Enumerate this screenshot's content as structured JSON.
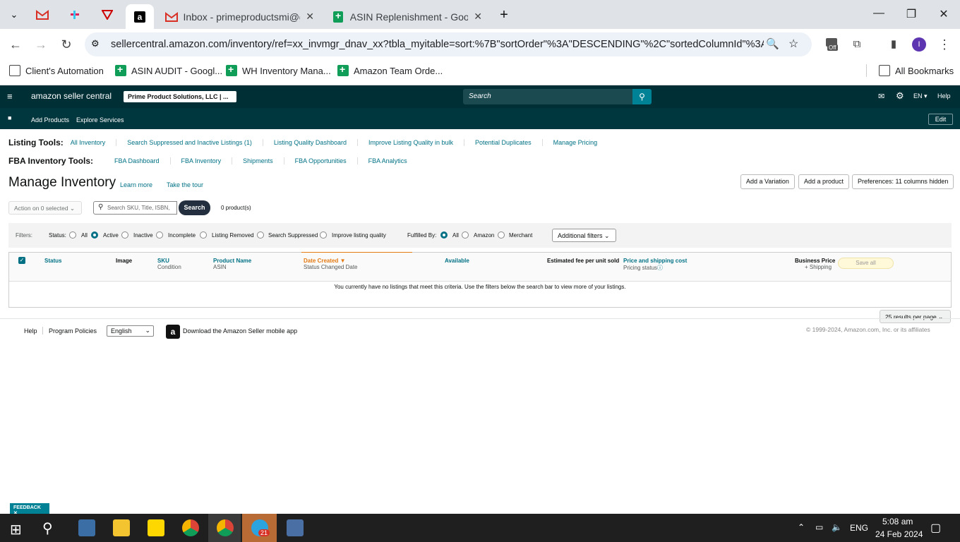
{
  "browser": {
    "tabs": [
      {
        "title": "Inbox - primeproductsmi@gma"
      },
      {
        "title": "ASIN Replenishment - Google S"
      }
    ],
    "url": "sellercentral.amazon.com/inventory/ref=xx_invmgr_dnav_xx?tbla_myitable=sort:%7B\"sortOrder\"%3A\"DESCENDING\"%2C\"sortedColumnId\"%3A\"date...",
    "profile_initial": "I",
    "ext_badge": "Off",
    "bookmarks": [
      "Client's Automation",
      "ASIN AUDIT - Googl...",
      "WH Inventory Mana...",
      "Amazon Team Orde..."
    ],
    "all_bookmarks": "All Bookmarks"
  },
  "seller": {
    "logo": "amazon seller central",
    "store": "Prime Product Solutions, LLC | ...",
    "search_placeholder": "Search",
    "lang": "EN",
    "help": "Help",
    "sub_nav": [
      "Add Products",
      "Explore Services"
    ],
    "edit": "Edit"
  },
  "listing_tools": {
    "label": "Listing Tools:",
    "links": [
      "All Inventory",
      "Search Suppressed and Inactive Listings (1)",
      "Listing Quality Dashboard",
      "Improve Listing Quality in bulk",
      "Potential Duplicates",
      "Manage Pricing"
    ]
  },
  "fba_tools": {
    "label": "FBA Inventory Tools:",
    "links": [
      "FBA Dashboard",
      "FBA Inventory",
      "Shipments",
      "FBA Opportunities",
      "FBA Analytics"
    ]
  },
  "page": {
    "title": "Manage Inventory",
    "learn_more": "Learn more",
    "tour": "Take the tour",
    "add_variation": "Add a Variation",
    "add_product": "Add a product",
    "preferences": "Preferences: 11 columns hidden",
    "action": "Action on 0 selected",
    "search_placeholder": "Search SKU, Title, ISBN,",
    "search_btn": "Search",
    "count": "0 product(s)"
  },
  "filters": {
    "label": "Filters:",
    "status_label": "Status:",
    "status": [
      "All",
      "Active",
      "Inactive",
      "Incomplete",
      "Listing Removed",
      "Search Suppressed",
      "Improve listing quality"
    ],
    "fulfilled_label": "Fulfilled By:",
    "fulfilled": [
      "All",
      "Amazon",
      "Merchant"
    ],
    "additional": "Additional filters"
  },
  "table": {
    "status": "Status",
    "image": "Image",
    "sku": "SKU",
    "condition": "Condition",
    "product_name": "Product Name",
    "asin": "ASIN",
    "date_created": "Date Created",
    "status_changed": "Status Changed Date",
    "available": "Available",
    "fee": "Estimated fee per unit sold",
    "price": "Price and shipping cost",
    "pricing_status": "Pricing status",
    "business_price": "Business Price",
    "shipping": "+ Shipping",
    "save_all": "Save all",
    "empty": "You currently have no listings that meet this criteria. Use the filters below the search bar to view more of your listings.",
    "per_page": "25 results per page"
  },
  "footer": {
    "help": "Help",
    "policies": "Program Policies",
    "language": "English",
    "app": "Download the Amazon Seller mobile app",
    "copyright": "© 1999-2024, Amazon.com, Inc. or its affiliates",
    "feedback": "FEEDBACK"
  },
  "taskbar": {
    "lang": "ENG",
    "time": "5:08 am",
    "date": "24 Feb 2024",
    "telegram_badge": "21"
  }
}
